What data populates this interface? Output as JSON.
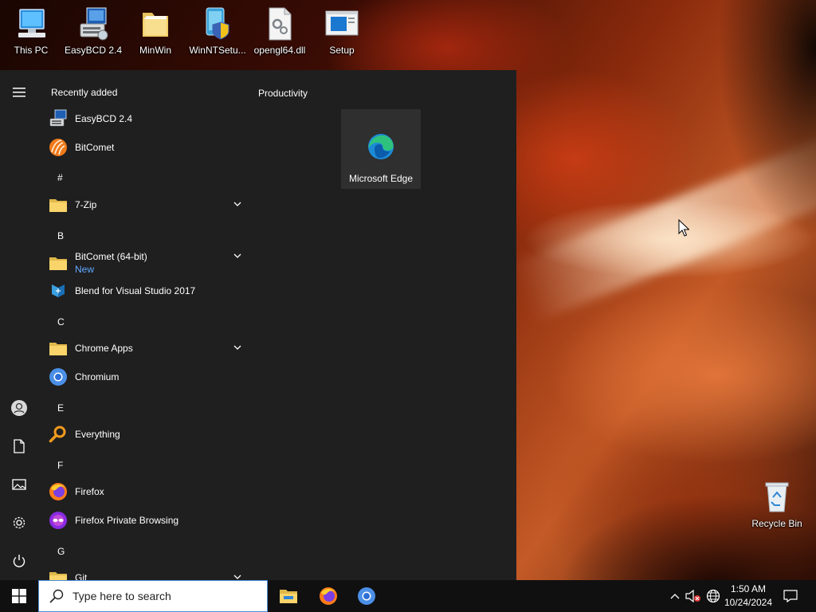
{
  "desktop": {
    "icons": [
      {
        "label": "This PC",
        "icon": "computer-icon"
      },
      {
        "label": "EasyBCD 2.4",
        "icon": "easybcd-icon"
      },
      {
        "label": "MinWin",
        "icon": "folder-icon"
      },
      {
        "label": "WinNTSetu...",
        "icon": "setup-shield-icon"
      },
      {
        "label": "opengl64.dll",
        "icon": "dll-file-icon"
      },
      {
        "label": "Setup",
        "icon": "setup-window-icon"
      }
    ],
    "recycle_bin": {
      "label": "Recycle Bin",
      "icon": "recycle-bin-icon"
    }
  },
  "start_menu": {
    "rail": [
      "hamburger-icon",
      "user-icon",
      "documents-icon",
      "pictures-icon",
      "settings-gear-icon",
      "power-icon"
    ],
    "recently_added_label": "Recently added",
    "recent": [
      {
        "name": "EasyBCD 2.4",
        "icon": "easybcd-icon"
      },
      {
        "name": "BitComet",
        "icon": "bitcomet-icon"
      }
    ],
    "groups": [
      {
        "letter": "#",
        "items": [
          {
            "name": "7-Zip",
            "icon": "folder-icon",
            "expandable": true
          }
        ]
      },
      {
        "letter": "B",
        "items": [
          {
            "name": "BitComet (64-bit)",
            "sub": "New",
            "icon": "folder-icon",
            "expandable": true
          },
          {
            "name": "Blend for Visual Studio 2017",
            "icon": "blend-icon"
          }
        ]
      },
      {
        "letter": "C",
        "items": [
          {
            "name": "Chrome Apps",
            "icon": "folder-icon",
            "expandable": true
          },
          {
            "name": "Chromium",
            "icon": "chromium-icon"
          }
        ]
      },
      {
        "letter": "E",
        "items": [
          {
            "name": "Everything",
            "icon": "everything-search-icon"
          }
        ]
      },
      {
        "letter": "F",
        "items": [
          {
            "name": "Firefox",
            "icon": "firefox-icon"
          },
          {
            "name": "Firefox Private Browsing",
            "icon": "firefox-private-icon"
          }
        ]
      },
      {
        "letter": "G",
        "items": [
          {
            "name": "Git",
            "icon": "folder-icon",
            "expandable": true
          }
        ]
      }
    ],
    "tiles_group": "Productivity",
    "tiles": [
      {
        "label": "Microsoft Edge",
        "icon": "edge-icon"
      }
    ]
  },
  "taskbar": {
    "search_placeholder": "Type here to search",
    "pinned": [
      "file-explorer-icon",
      "firefox-icon",
      "chromium-icon"
    ],
    "tray": [
      "chevron-up-icon",
      "volume-muted-icon",
      "network-globe-icon"
    ],
    "time": "1:50 AM",
    "date": "10/24/2024"
  },
  "colors": {
    "start_bg": "#1f1f1f",
    "tile_bg": "#2f2f2f",
    "taskbar_bg": "#101010",
    "accent_new": "#60a8ff"
  }
}
